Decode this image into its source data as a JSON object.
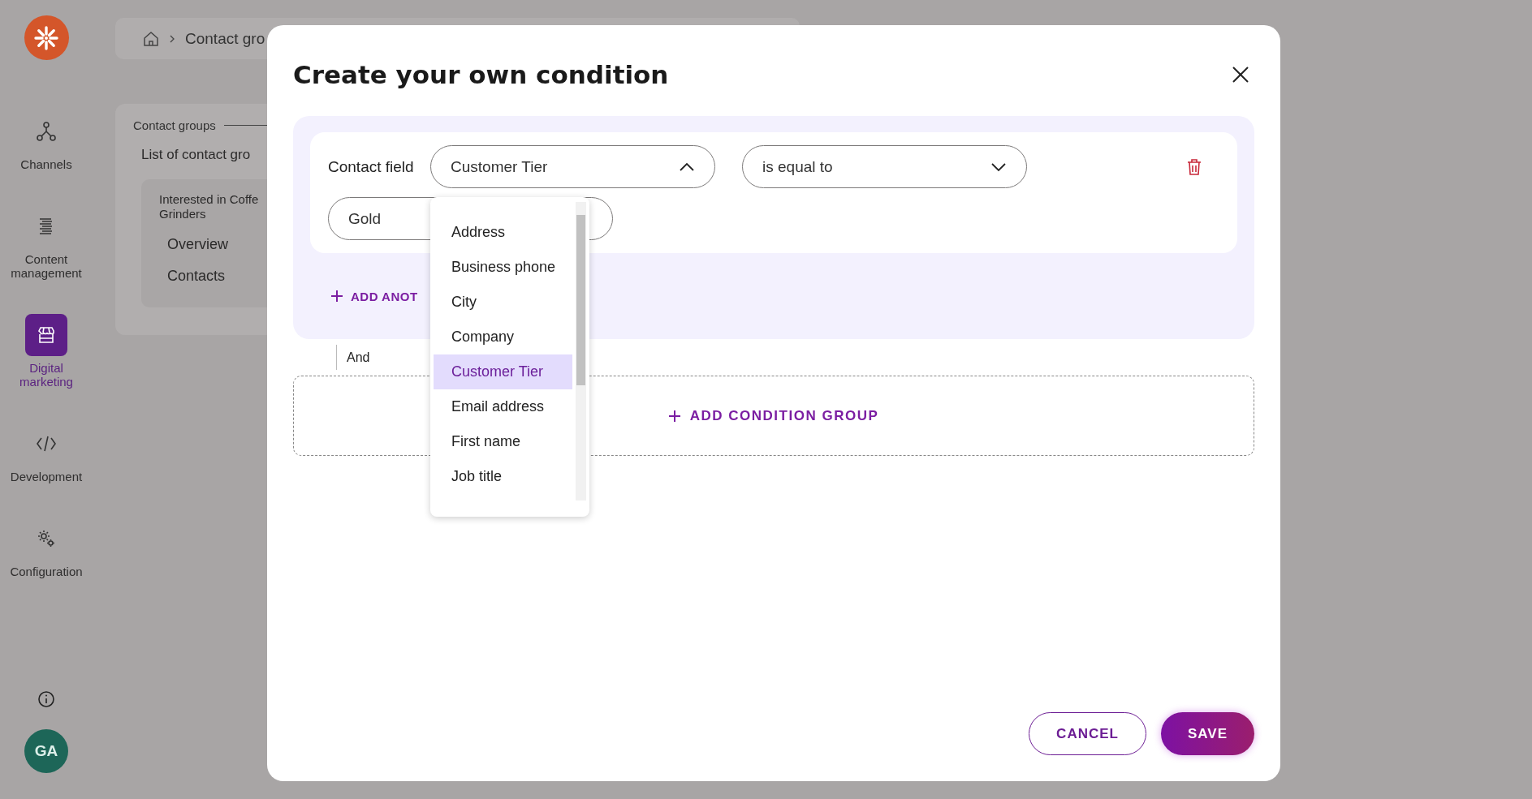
{
  "sidebar": {
    "items": [
      {
        "label": "Channels",
        "selected": false
      },
      {
        "label": "Content management",
        "selected": false
      },
      {
        "label": "Digital marketing",
        "selected": true
      },
      {
        "label": "Development",
        "selected": false
      },
      {
        "label": "Configuration",
        "selected": false
      }
    ],
    "avatar": "GA"
  },
  "breadcrumb": {
    "items": [
      "Contact gro"
    ]
  },
  "background_card": {
    "section": "Contact groups",
    "title": "List of contact gro",
    "group_name": "Interested in Coffe\nGrinders",
    "links": [
      "Overview",
      "Contacts"
    ]
  },
  "dialog": {
    "title": "Create your own condition",
    "condition": {
      "field_label": "Contact field",
      "field_select": {
        "value": "Customer Tier",
        "expanded": true
      },
      "operator_select": {
        "value": "is equal to",
        "expanded": false
      },
      "value_field": {
        "value": "Gold"
      },
      "add_button": "ADD ANOT"
    },
    "options": [
      {
        "label": "Address",
        "selected": false
      },
      {
        "label": "Business phone",
        "selected": false
      },
      {
        "label": "City",
        "selected": false
      },
      {
        "label": "Company",
        "selected": false
      },
      {
        "label": "Customer Tier",
        "selected": true
      },
      {
        "label": "Email address",
        "selected": false
      },
      {
        "label": "First name",
        "selected": false
      },
      {
        "label": "Job title",
        "selected": false
      }
    ],
    "connector": "And",
    "add_group_button": "ADD CONDITION GROUP",
    "buttons": [
      {
        "label": "CANCEL",
        "kind": "secondary"
      },
      {
        "label": "SAVE",
        "kind": "primary"
      }
    ]
  }
}
